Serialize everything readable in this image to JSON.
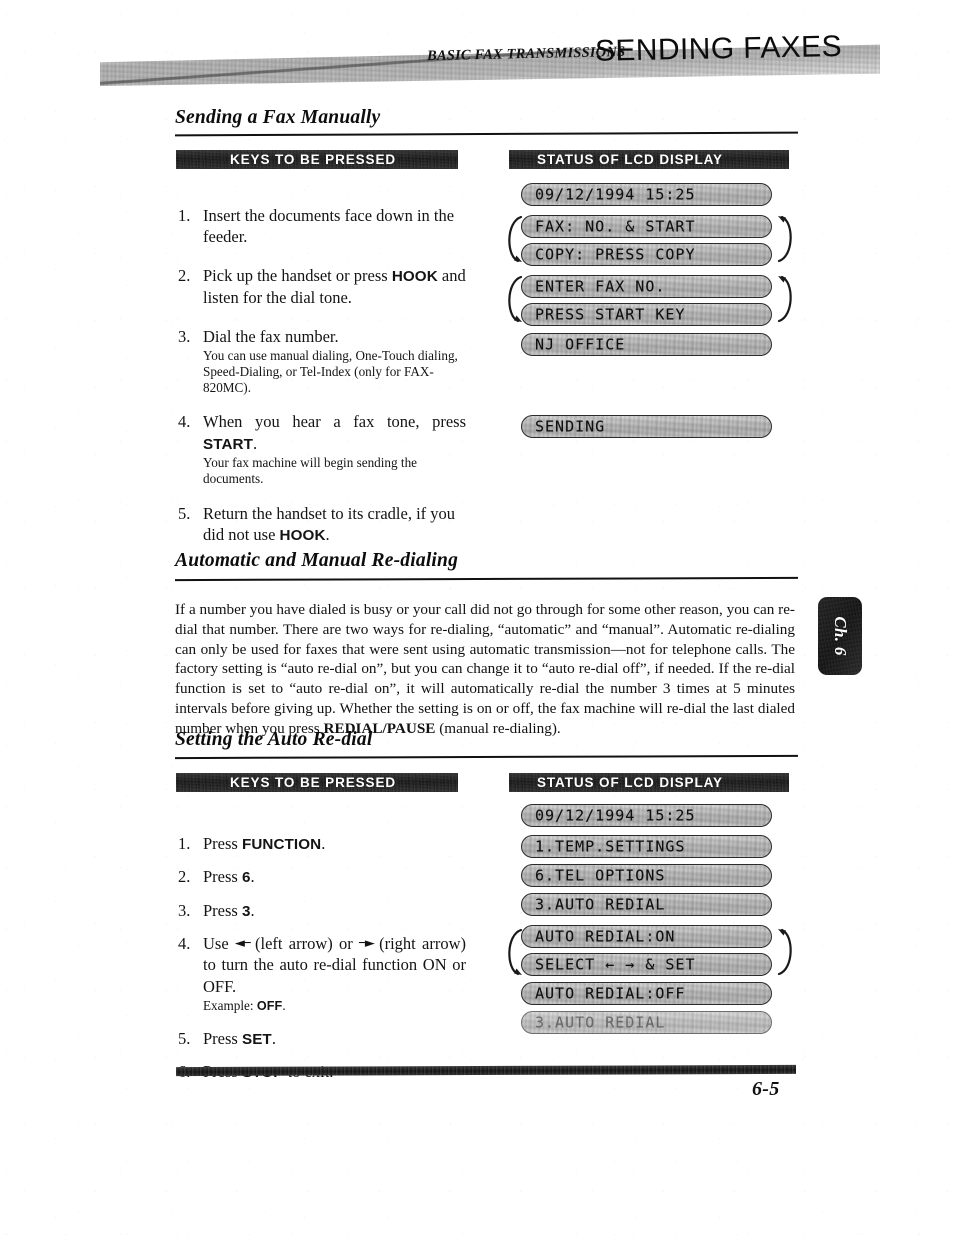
{
  "header": {
    "subtitle": "BASIC FAX TRANSMISSIONS",
    "title": "SENDING FAXES"
  },
  "chapter_tab": {
    "label": "Ch. 6"
  },
  "footer": {
    "page_number": "6-5"
  },
  "section1": {
    "heading": "Sending a Fax Manually",
    "keys_banner": "KEYS TO BE PRESSED",
    "lcd_banner": "STATUS OF LCD DISPLAY",
    "steps": [
      {
        "num": "1.",
        "text": "Insert the documents face down in the feeder.",
        "note": ""
      },
      {
        "num": "2.",
        "text_pre": "Pick up the handset or press ",
        "key": "HOOK",
        "text_post": " and listen for the dial tone.",
        "note": ""
      },
      {
        "num": "3.",
        "text": "Dial the fax number.",
        "note": "You can use manual dialing, One-Touch dialing, Speed-Dialing, or Tel-Index (only for FAX-820MC)."
      },
      {
        "num": "4.",
        "text_pre": "When you hear a fax tone, press ",
        "key": "START",
        "text_post": ".",
        "note": "Your fax machine will begin sending the documents."
      },
      {
        "num": "5.",
        "text_pre": "Return the handset to its cradle, if you did not use ",
        "key": "HOOK",
        "text_post": ".",
        "note": ""
      }
    ],
    "lcd_rows": [
      "09/12/1994 15:25",
      "FAX: NO. & START",
      "COPY: PRESS COPY",
      "ENTER FAX NO.",
      "PRESS START KEY",
      "NJ OFFICE",
      "SENDING"
    ]
  },
  "section2": {
    "heading": "Automatic and Manual Re-dialing",
    "paragraph_part1": "If a number you have dialed is busy or your call did not go through for some other reason, you can re-dial that number. There are two ways for re-dialing, “automatic” and “manual”. Automatic re-dialing can only be used for faxes that were sent using automatic transmission—not for telephone calls. The factory setting is “auto re-dial on”, but you can change it to “auto re-dial off”, if needed. If the re-dial function is set to “auto re-dial on”, it will automatically re-dial the number 3 times at 5 minutes intervals before giving up. Whether the setting is on or off, the fax machine will re-dial the last dialed number when you press ",
    "paragraph_bold": "REDIAL/PAUSE",
    "paragraph_part2": " (manual re-dialing)."
  },
  "section3": {
    "heading": "Setting the Auto Re-dial",
    "keys_banner": "KEYS TO BE PRESSED",
    "lcd_banner": "STATUS OF LCD DISPLAY",
    "steps": [
      {
        "num": "1.",
        "text_pre": "Press ",
        "key": "FUNCTION",
        "text_post": ".",
        "note": ""
      },
      {
        "num": "2.",
        "text_pre": "Press ",
        "key": "6",
        "text_post": ".",
        "note": ""
      },
      {
        "num": "3.",
        "text_pre": "Press ",
        "key": "3",
        "text_post": ".",
        "note": ""
      },
      {
        "num": "4.",
        "text_pre": "Use ",
        "arrow_left": "◄─",
        "text_mid1": " (left arrow) or ",
        "arrow_right": "─►",
        "text_mid2": " (right arrow) to turn the auto re-dial function ON or OFF.",
        "note_label": "Example: ",
        "note_key": "OFF",
        "note_post": "."
      },
      {
        "num": "5.",
        "text_pre": "Press ",
        "key": "SET",
        "text_post": ".",
        "note": ""
      },
      {
        "num": "6.",
        "text_pre": "Press ",
        "key": "STOP",
        "text_post": " to exit.",
        "note": ""
      }
    ],
    "lcd_rows": [
      "09/12/1994 15:25",
      "1.TEMP.SETTINGS",
      "6.TEL OPTIONS",
      "3.AUTO REDIAL",
      "AUTO REDIAL:ON",
      "SELECT ← → & SET",
      "AUTO REDIAL:OFF",
      "3.AUTO REDIAL"
    ]
  }
}
